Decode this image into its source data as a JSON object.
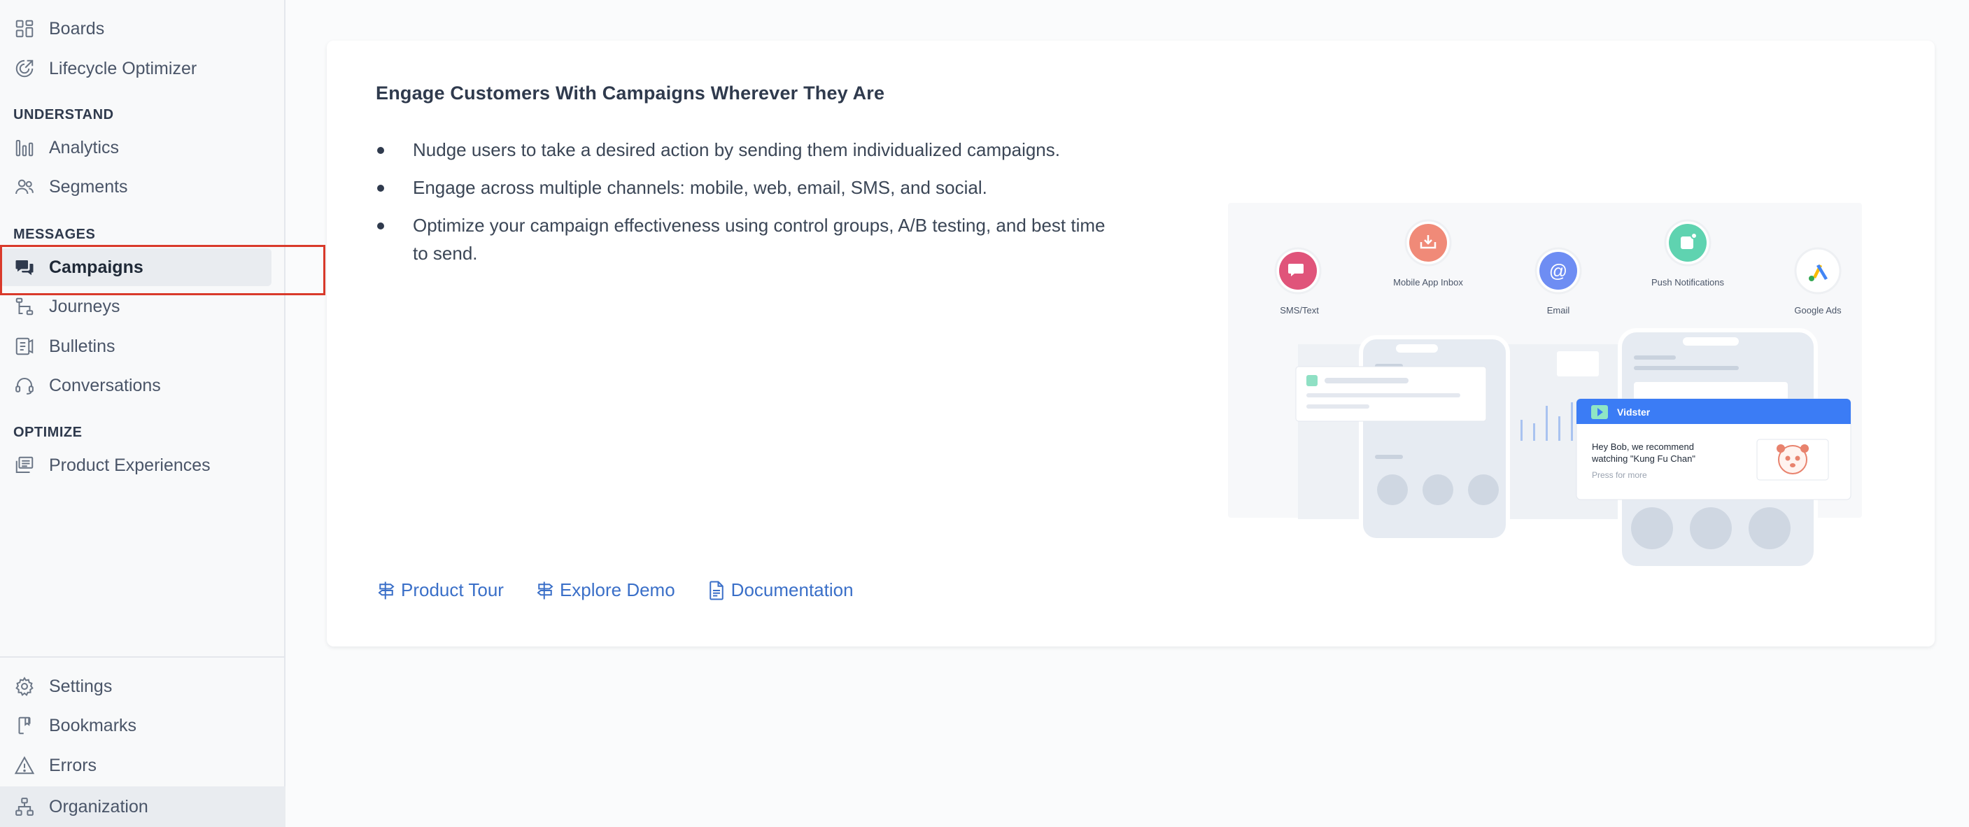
{
  "sidebar": {
    "top_items": [
      {
        "label": "Boards",
        "icon": "boards-icon"
      },
      {
        "label": "Lifecycle Optimizer",
        "icon": "lifecycle-icon"
      }
    ],
    "sections": [
      {
        "header": "UNDERSTAND",
        "items": [
          {
            "label": "Analytics",
            "icon": "bar-chart-icon"
          },
          {
            "label": "Segments",
            "icon": "users-icon"
          }
        ]
      },
      {
        "header": "MESSAGES",
        "items": [
          {
            "label": "Campaigns",
            "icon": "chat-bubbles-icon",
            "active": true
          },
          {
            "label": "Journeys",
            "icon": "journey-icon"
          },
          {
            "label": "Bulletins",
            "icon": "bulletin-icon"
          },
          {
            "label": "Conversations",
            "icon": "headset-icon"
          }
        ]
      },
      {
        "header": "OPTIMIZE",
        "items": [
          {
            "label": "Product Experiences",
            "icon": "stacked-layers-icon"
          }
        ]
      }
    ],
    "bottom_items": [
      {
        "label": "Settings",
        "icon": "gear-icon"
      },
      {
        "label": "Bookmarks",
        "icon": "bookmark-icon"
      },
      {
        "label": "Errors",
        "icon": "warning-icon"
      },
      {
        "label": "Organization",
        "icon": "org-chart-icon"
      }
    ]
  },
  "main": {
    "title": "Engage Customers With Campaigns Wherever They Are",
    "bullets": [
      "Nudge users to take a desired action by sending them individualized campaigns.",
      "Engage across multiple channels: mobile, web, email, SMS, and social.",
      "Optimize your campaign effectiveness using control groups, A/B testing, and best time to send."
    ],
    "links": [
      {
        "label": "Product Tour",
        "icon": "signpost-icon"
      },
      {
        "label": "Explore Demo",
        "icon": "signpost-icon"
      },
      {
        "label": "Documentation",
        "icon": "document-icon"
      }
    ],
    "illustration": {
      "channels": [
        "SMS/Text",
        "Mobile App Inbox",
        "Email",
        "Push Notifications",
        "Google Ads"
      ],
      "notification": {
        "app": "Vidster",
        "message_line1": "Hey Bob, we recommend",
        "message_line2": "watching \"Kung Fu Chan\"",
        "hint": "Press for more"
      }
    }
  },
  "colors": {
    "accent_link": "#3a6fc8",
    "highlight": "#d93a2b",
    "sms": "#e0547a",
    "inbox": "#f08a78",
    "email": "#6e8df3",
    "push": "#5fd3b0",
    "notification_header": "#3b7cf5"
  }
}
